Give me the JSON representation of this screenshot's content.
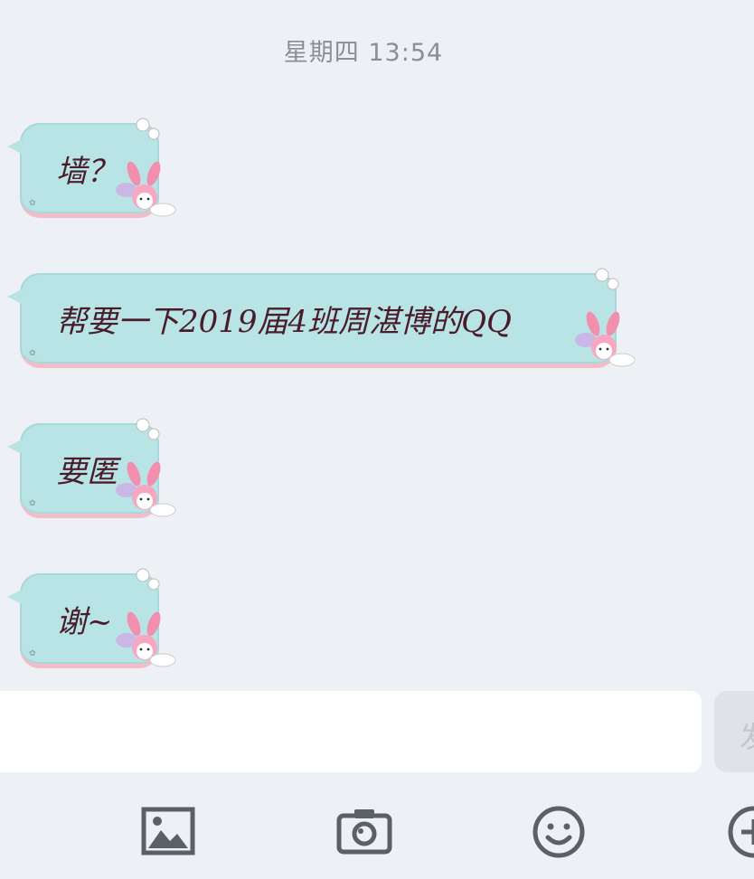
{
  "timestamp": "星期四 13:54",
  "messages": [
    {
      "text": "墙？"
    },
    {
      "text": "帮要一下2019届4班周湛博的QQ"
    },
    {
      "text": "要匿"
    },
    {
      "text": "谢~"
    }
  ],
  "input": {
    "value": "",
    "placeholder": ""
  },
  "send_button": {
    "label": "发"
  },
  "toolbar": {
    "icons": [
      "image-icon",
      "camera-icon",
      "emoji-icon",
      "plus-icon"
    ]
  },
  "colors": {
    "background": "#edf1f6",
    "bubble": "#b8e4e6",
    "bubble_border": "#f4bcc8",
    "message_text": "#4a1c2a",
    "icon": "#5b6066"
  }
}
